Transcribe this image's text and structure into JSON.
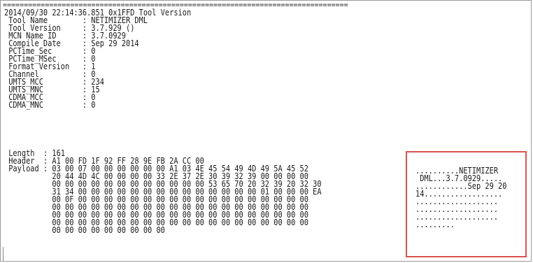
{
  "separator": "==================================================================================",
  "header_line": "2014/09/30 22:14:36.851 0x1FFD Tool Version",
  "fields": [
    {
      "label": " Tool Name        ",
      "value": "NETIMIZER DML"
    },
    {
      "label": " Tool Version     ",
      "value": "3.7.929 ()"
    },
    {
      "label": " MCN Name ID      ",
      "value": "3.7.0929"
    },
    {
      "label": " Compile Date     ",
      "value": "Sep 29 2014"
    },
    {
      "label": " PCTime_Sec       ",
      "value": "0"
    },
    {
      "label": " PCTime_MSec      ",
      "value": "0"
    },
    {
      "label": " Format Version   ",
      "value": "1"
    },
    {
      "label": " Channel          ",
      "value": "0"
    },
    {
      "label": " UMTS_MCC         ",
      "value": "234"
    },
    {
      "label": " UMTS_MNC         ",
      "value": "15"
    },
    {
      "label": " CDMA_MCC         ",
      "value": "0"
    },
    {
      "label": " CDMA_MNC         ",
      "value": "0"
    }
  ],
  "packet": {
    "length_label": " Length ",
    "length_value": "161",
    "header_label": " Header ",
    "header_value": "A1 00 FD 1F 92 FF 28 9E FB 2A CC 00",
    "payload_label": " Payload",
    "payload_rows": [
      "03 00 07 00 00 00 00 00 00 A1 03 4E 45 54 49 4D 49 5A 45 52",
      "20 44 4D 4C 00 00 00 00 33 2E 37 2E 30 39 32 39 00 00 00 00",
      "00 00 00 00 00 00 00 00 00 00 00 00 53 65 70 20 32 39 20 32 30",
      "31 34 00 00 00 00 00 00 00 00 00 00 00 00 00 00 01 00 00 00 EA",
      "00 0F 00 00 00 00 00 00 00 00 00 00 00 00 00 00 00 00 00 00",
      "00 00 00 00 00 00 00 00 00 00 00 00 00 00 00 00 00 00 00 00",
      "00 00 00 00 00 00 00 00 00 00 00 00 00 00 00 00 00 00 00 00",
      "00 00 00 00 00 00 00 00 00 00 00 00 00 00 00 00 00 00 00 00",
      "00 00 00 00 00 00 00 00 00"
    ]
  },
  "ascii_rows": [
    "..........NETIMIZER",
    " DML...3.7.0929.....",
    "............Sep 29 20",
    "14..................",
    "...................",
    "...................",
    "...................",
    "........."
  ]
}
